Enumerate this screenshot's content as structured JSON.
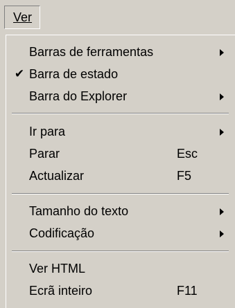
{
  "menubar": {
    "ver_label": "Ver"
  },
  "menu": {
    "toolbars": "Barras de ferramentas",
    "status_bar": "Barra de estado",
    "status_bar_checked": "✔",
    "explorer_bar": "Barra do Explorer",
    "go_to": "Ir para",
    "stop": "Parar",
    "stop_shortcut": "Esc",
    "refresh": "Actualizar",
    "refresh_shortcut": "F5",
    "text_size": "Tamanho do texto",
    "encoding": "Codificação",
    "view_html": "Ver HTML",
    "full_screen": "Ecrã inteiro",
    "full_screen_shortcut": "F11"
  }
}
